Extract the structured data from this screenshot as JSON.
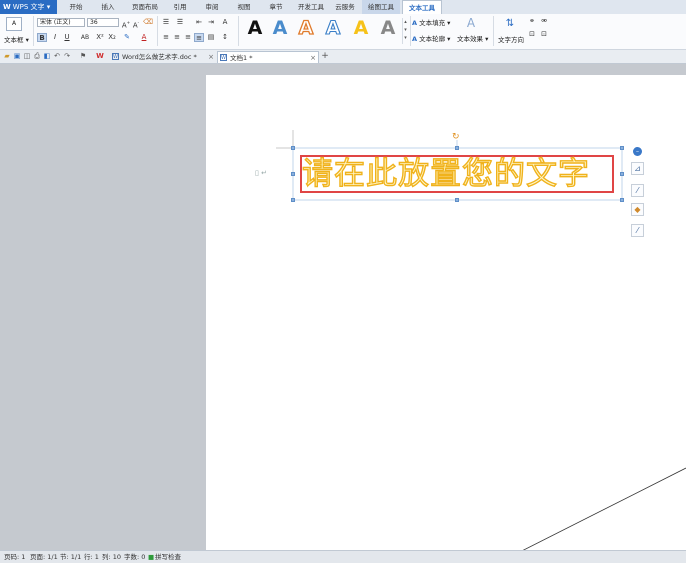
{
  "app": {
    "name": "WPS 文字",
    "logo": "W"
  },
  "ribbon_tabs": [
    "开始",
    "插入",
    "页面布局",
    "引用",
    "审阅",
    "视图",
    "章节",
    "开发工具",
    "云服务",
    "绘图工具",
    "文本工具"
  ],
  "ribbon_active_tab": "文本工具",
  "ribbon": {
    "textbox_label": "文本框",
    "font_name": "宋体 (正文)",
    "font_size": "36",
    "wordart_glyph": "A",
    "text_fill": "文本填充",
    "text_outline": "文本轮廓",
    "text_effect": "文本效果",
    "text_direction": "文字方向"
  },
  "document_tabs": [
    {
      "label": "Word怎么做艺术字.doc *",
      "active": false
    },
    {
      "label": "文档1 *",
      "active": true
    }
  ],
  "new_tab_icon": "+",
  "document": {
    "wordart_text": "请在此放置您的文字"
  },
  "status_bar": {
    "page_number": "页码: 1",
    "pages": "页面: 1/1",
    "section": "节: 1/1",
    "row": "行: 1",
    "column": "列: 10",
    "word_count": "字数: 0",
    "spell_check": "拼写检查"
  },
  "colors": {
    "accent": "#2a6cc3",
    "wordart_outline": "#f0b21c",
    "selection_border": "#e04545"
  }
}
